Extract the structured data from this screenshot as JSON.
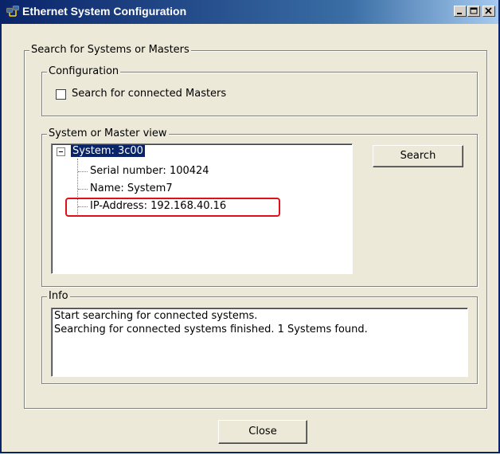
{
  "window": {
    "title": "Ethernet System Configuration",
    "icons": {
      "app": "network-app-icon",
      "minimize": "minimize-icon",
      "maximize": "maximize-icon",
      "close": "close-icon"
    }
  },
  "search_group": {
    "label": "Search for Systems or Masters"
  },
  "configuration": {
    "label": "Configuration",
    "checkbox_label": "Search for connected Masters",
    "checked": false
  },
  "view": {
    "label": "System or Master view",
    "tree": {
      "root": "System: 3c00",
      "children": [
        "Serial number: 100424",
        "Name: System7",
        "IP-Address: 192.168.40.16"
      ]
    },
    "search_button": "Search"
  },
  "info": {
    "label": "Info",
    "lines": [
      "Start searching for connected systems.",
      "Searching for connected systems finished. 1 Systems found."
    ]
  },
  "footer": {
    "close_button": "Close"
  },
  "colors": {
    "title_bar": "#0a246a",
    "window_bg": "#ece9d8",
    "selection": "#0a246a",
    "highlight": "#e0101a"
  }
}
